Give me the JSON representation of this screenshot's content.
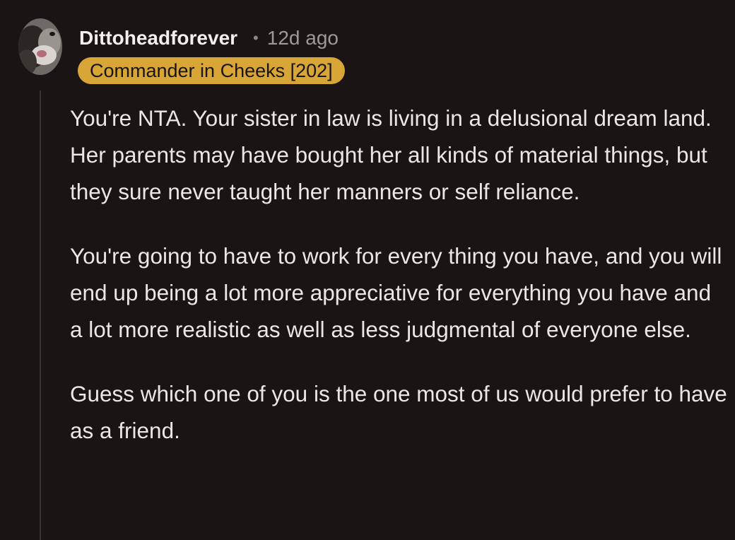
{
  "comment": {
    "avatar_icon": "dog-avatar-icon",
    "username": "Dittoheadforever",
    "separator": "•",
    "timestamp": "12d ago",
    "flair": "Commander in Cheeks [202]",
    "paragraphs": [
      "You're NTA. Your sister in law is living in a delusional dream land. Her parents may have bought her all kinds of material things, but they sure never taught her manners or self reliance.",
      "You're going to have to work for every thing you have, and you will end up being a lot more appreciative for everything you have and a lot more realistic as well as less judgmental of everyone else.",
      "Guess which one of you is the one most of us would prefer to have as a friend."
    ]
  },
  "colors": {
    "background": "#1a1514",
    "text": "#ece6e4",
    "muted_text": "#a09896",
    "flair_background": "#d8a636",
    "thread_line": "#3a3332"
  }
}
